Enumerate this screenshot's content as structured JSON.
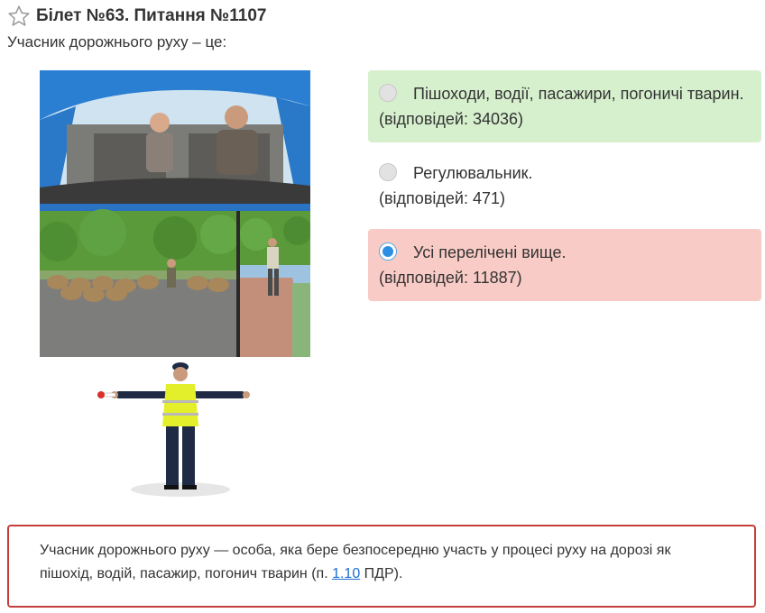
{
  "ticket": {
    "title": "Білет №63. Питання №1107",
    "star_icon": "star-outline-icon"
  },
  "question": {
    "text": "Учасник дорожнього руху – це:"
  },
  "answers": [
    {
      "text": "Пішоходи, водії, пасажири, погоничі тварин.",
      "count": "(відповідей: 34036)",
      "state": "correct",
      "selected": false
    },
    {
      "text": "Регулювальник.",
      "count": "(відповідей: 471)",
      "state": "neutral",
      "selected": false
    },
    {
      "text": "Усі перелічені вище.",
      "count": "(відповідей: 11887)",
      "state": "wrong",
      "selected": true
    }
  ],
  "explanation": {
    "text_before": "Учасник дорожнього руху — особа, яка бере безпосередню участь у процесі руху на дорозі як пішохід, водій, пасажир, погонич тварин (п. ",
    "link_text": "1.10",
    "text_after": " ПДР)."
  },
  "colors": {
    "correct_bg": "#d6f0cd",
    "wrong_bg": "#f8cbc6",
    "explanation_border": "#c73d3d",
    "link": "#1a6fd0",
    "radio_selected": "#2d8fe3"
  }
}
